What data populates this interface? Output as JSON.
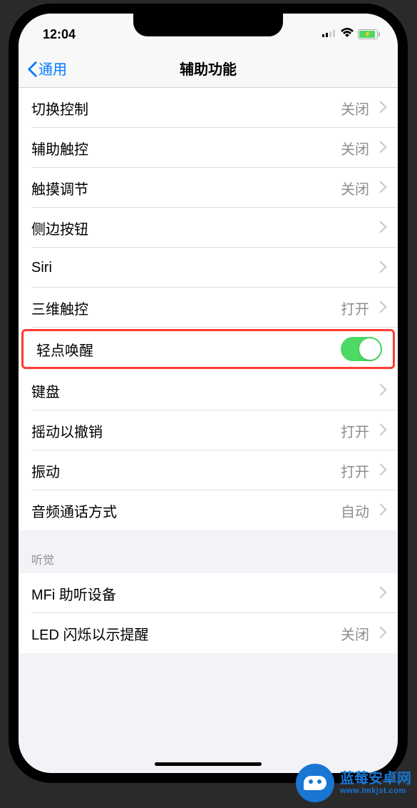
{
  "status": {
    "time": "12:04"
  },
  "nav": {
    "back_label": "通用",
    "title": "辅助功能"
  },
  "values": {
    "off": "关闭",
    "on": "打开",
    "auto": "自动"
  },
  "rows": {
    "switch_control": "切换控制",
    "assistive_touch": "辅助触控",
    "touch_accom": "触摸调节",
    "side_button": "侧边按钮",
    "siri": "Siri",
    "three_d_touch": "三维触控",
    "tap_to_wake": "轻点唤醒",
    "keyboard": "键盘",
    "shake_undo": "摇动以撤销",
    "vibration": "振动",
    "call_audio": "音频通话方式",
    "mfi_hearing": "MFi 助听设备",
    "led_flash": "LED 闪烁以示提醒"
  },
  "sections": {
    "hearing": "听觉"
  },
  "watermark": {
    "name": "蓝莓安卓网",
    "url": "www.lmkjst.com"
  }
}
